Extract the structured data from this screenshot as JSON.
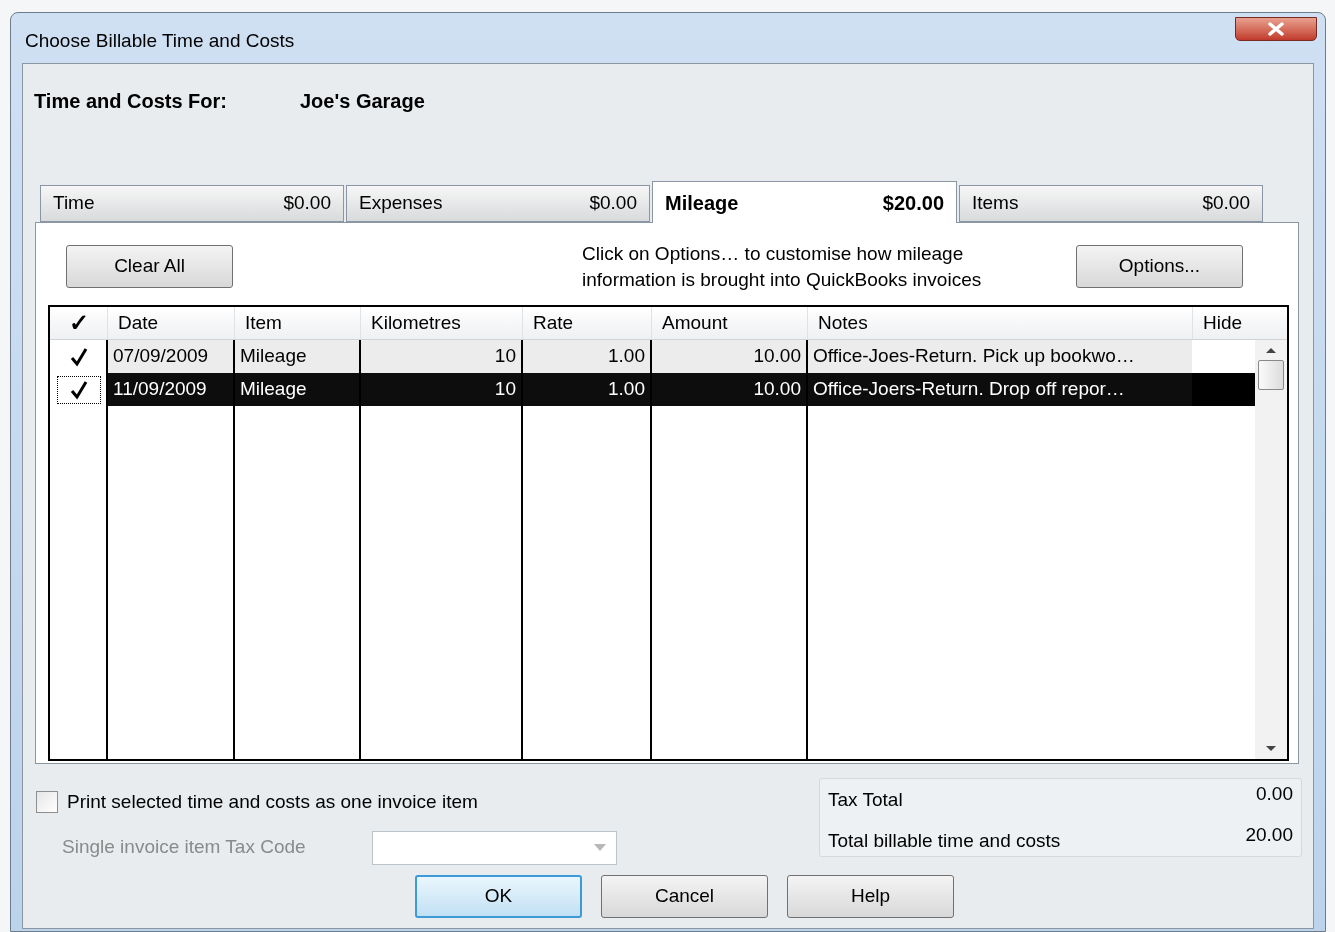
{
  "window": {
    "title": "Choose Billable Time and Costs"
  },
  "header": {
    "label": "Time and Costs For:",
    "customer": "Joe's Garage"
  },
  "tabs": [
    {
      "label": "Time",
      "amount": "$0.00",
      "selected": false
    },
    {
      "label": "Expenses",
      "amount": "$0.00",
      "selected": false
    },
    {
      "label": "Mileage",
      "amount": "$20.00",
      "selected": true
    },
    {
      "label": "Items",
      "amount": "$0.00",
      "selected": false
    }
  ],
  "clear_button": "Clear All",
  "info_text": "Click on Options… to customise how mileage information is brought into QuickBooks invoices",
  "options_button": "Options...",
  "table": {
    "check_header": "✓",
    "columns": [
      "Date",
      "Item",
      "Kilometres",
      "Rate",
      "Amount",
      "Notes",
      "Hide"
    ],
    "rows": [
      {
        "checked": true,
        "selected": false,
        "cells": [
          "07/09/2009",
          "Mileage",
          "10",
          "1.00",
          "10.00",
          "Office-Joes-Return.  Pick up bookwo…"
        ]
      },
      {
        "checked": true,
        "selected": true,
        "cells": [
          "11/09/2009",
          "Mileage",
          "10",
          "1.00",
          "10.00",
          "Office-Joers-Return.  Drop off repor…"
        ]
      }
    ]
  },
  "print_option": {
    "label": "Print selected time and costs as one invoice item",
    "checked": false
  },
  "tax_code": {
    "label": "Single invoice item Tax Code",
    "disabled": true
  },
  "totals": [
    {
      "label": "Tax Total",
      "value": "0.00"
    },
    {
      "label": "Total billable time and costs",
      "value": "20.00"
    }
  ],
  "buttons": [
    {
      "label": "OK",
      "default": true
    },
    {
      "label": "Cancel",
      "default": false
    },
    {
      "label": "Help",
      "default": false
    }
  ]
}
